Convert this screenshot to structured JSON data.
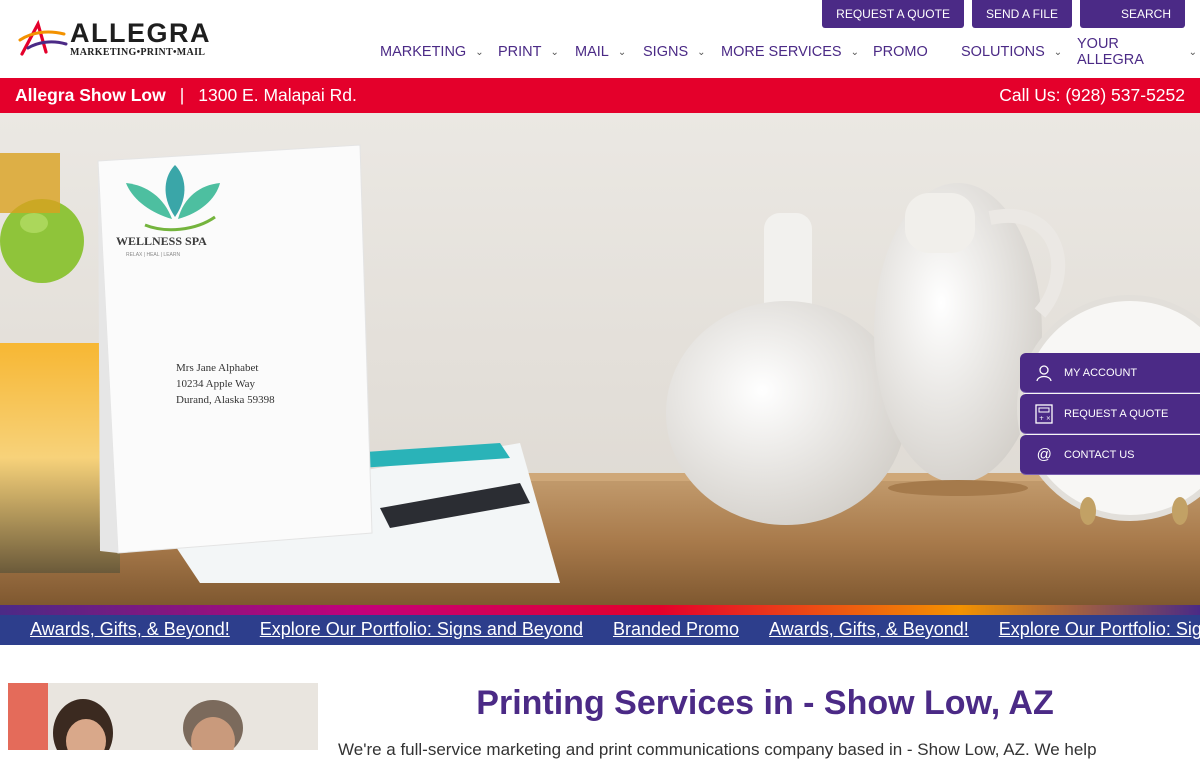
{
  "brand": {
    "name": "ALLEGRA",
    "tagline": "MARKETING•PRINT•MAIL"
  },
  "top_buttons": [
    {
      "label": "REQUEST A QUOTE"
    },
    {
      "label": "SEND A FILE"
    },
    {
      "label": "SEARCH",
      "icon": "search-icon"
    }
  ],
  "nav": [
    {
      "label": "MARKETING",
      "has_dropdown": true
    },
    {
      "label": "PRINT",
      "has_dropdown": true
    },
    {
      "label": "MAIL",
      "has_dropdown": true
    },
    {
      "label": "SIGNS",
      "has_dropdown": true
    },
    {
      "label": "MORE SERVICES",
      "has_dropdown": true
    },
    {
      "label": "PROMO",
      "has_dropdown": false
    },
    {
      "label": "SOLUTIONS",
      "has_dropdown": true
    },
    {
      "label": "YOUR ALLEGRA",
      "has_dropdown": true
    }
  ],
  "location_bar": {
    "location_name": "Allegra Show Low",
    "separator": "|",
    "address": "1300 E. Malapai Rd.",
    "phone": "Call Us: (928) 537-5252"
  },
  "hero": {
    "envelope_brand": "WELLNESS SPA",
    "envelope_sub": "RELAX | HEAL | LEARN",
    "address_lines": [
      "Mrs Jane Alphabet",
      "10234 Apple Way",
      "Durand, Alaska 59398"
    ]
  },
  "side_menu": [
    {
      "label": "MY ACCOUNT",
      "icon": "user-icon"
    },
    {
      "label": "REQUEST A QUOTE",
      "icon": "calculator-icon"
    },
    {
      "label": "CONTACT US",
      "icon": "at-icon"
    }
  ],
  "ticker": [
    "Awards, Gifts, & Beyond!",
    "Explore Our Portfolio: Signs and Beyond",
    "Branded Promo",
    "Awards, Gifts, & Beyond!",
    "Explore Our Portfolio: Signs and Beyond"
  ],
  "main": {
    "heading": "Printing Services in - Show Low, AZ",
    "intro": "We're a full-service marketing and print communications company based in - Show Low, AZ. We help"
  },
  "colors": {
    "brand_purple": "#4b2a86",
    "red_bar": "#e4002b",
    "ticker_blue": "#2d3e8c"
  }
}
